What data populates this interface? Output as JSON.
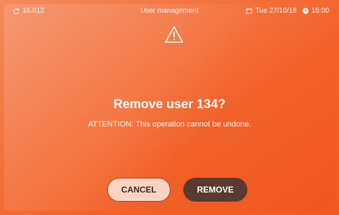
{
  "status_bar": {
    "left_value": "16.012",
    "left_icon": "refresh-icon",
    "title": "User management",
    "date": "Tue 27/10/18",
    "date_icon": "calendar-icon",
    "time": "15:00",
    "time_icon": "clock-icon"
  },
  "dialog": {
    "icon": "warning-icon",
    "title": "Remove user 134?",
    "message": "ATTENTION: This operation cannot be undone."
  },
  "buttons": {
    "cancel_label": "CANCEL",
    "remove_label": "REMOVE"
  },
  "colors": {
    "background": "#f3733f",
    "cancel_bg": "#fbd3c2",
    "remove_bg": "#5a3a2f"
  }
}
